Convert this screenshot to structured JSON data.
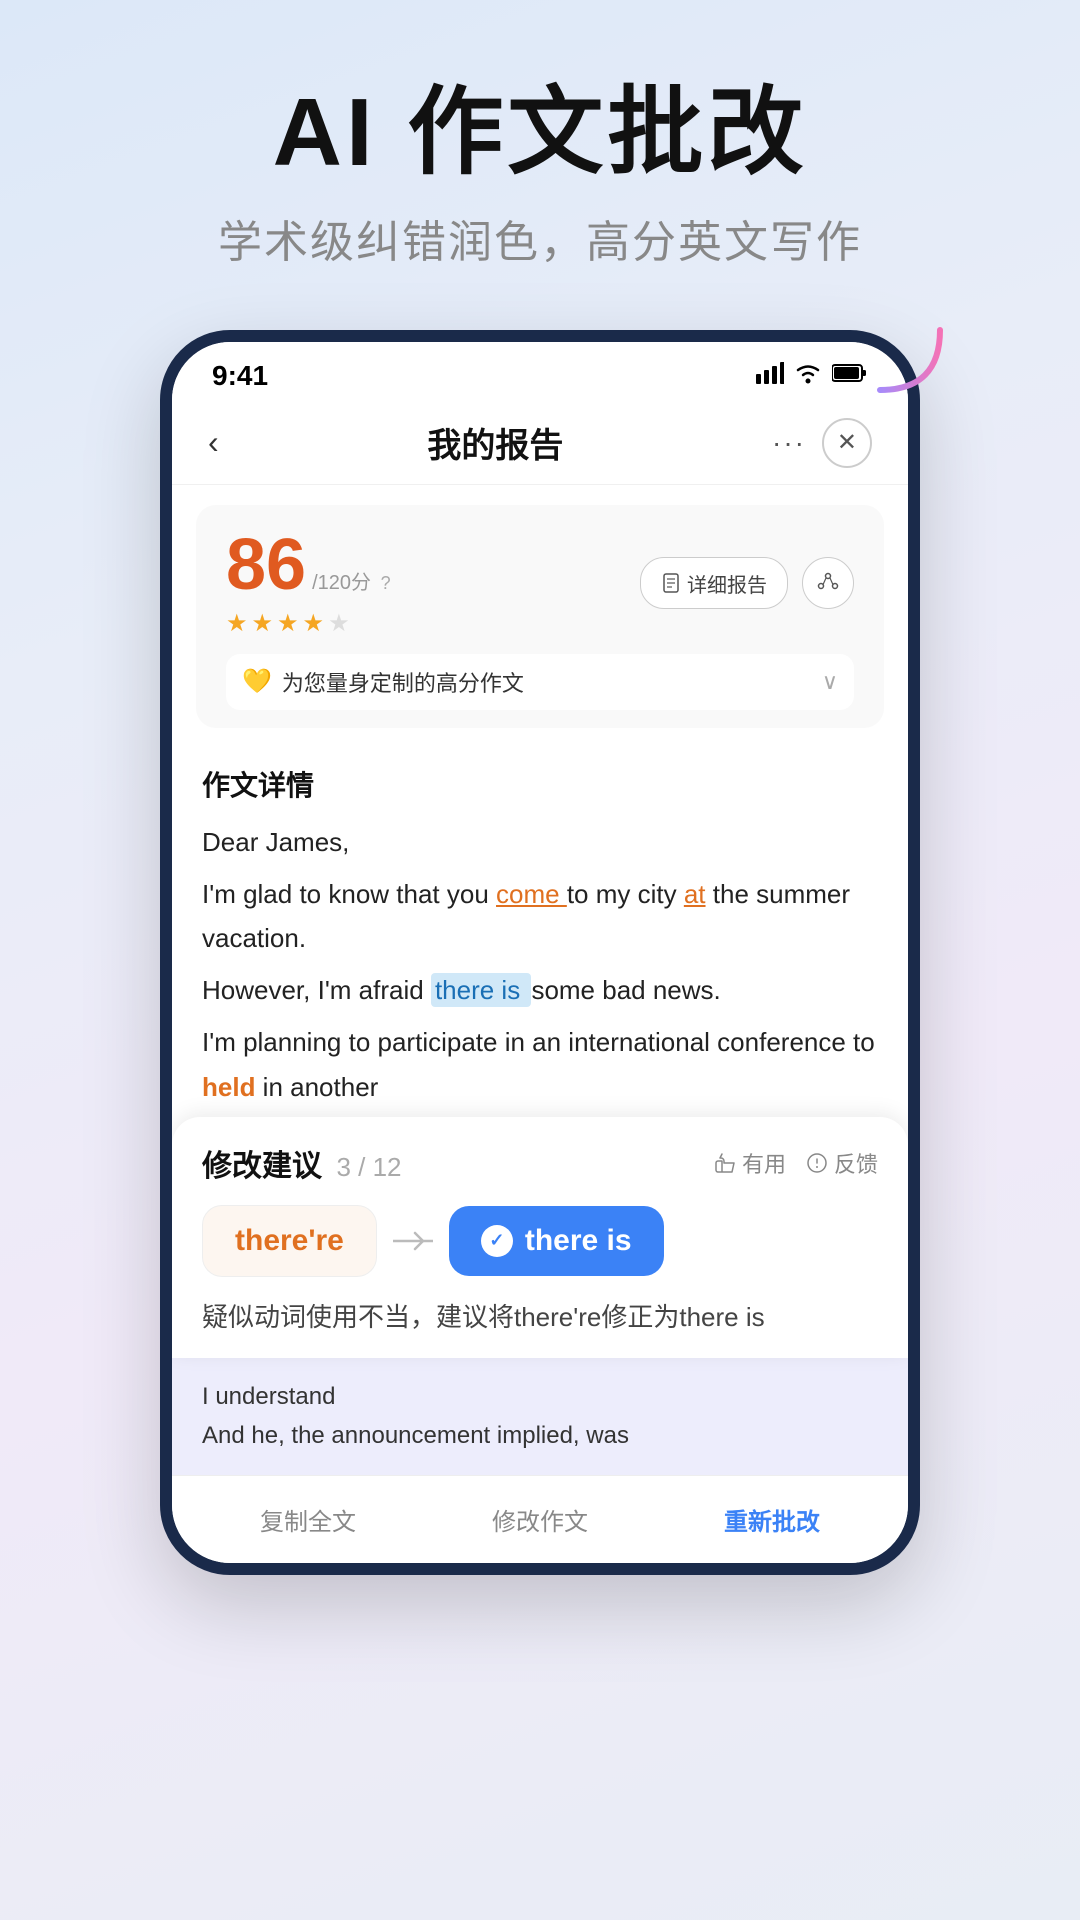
{
  "header": {
    "title": "AI 作文批改",
    "subtitle": "学术级纠错润色，高分英文写作"
  },
  "phone": {
    "status_bar": {
      "time": "9:41"
    },
    "nav": {
      "title": "我的报告",
      "more_label": "···"
    },
    "score_card": {
      "score": "86",
      "score_max": "/120分",
      "score_help": "?",
      "stars_full": 4,
      "stars_empty": 1,
      "btn_report": "详细报告",
      "custom_hint": "为您量身定制的高分作文"
    },
    "essay": {
      "section_title": "作文详情",
      "paragraphs": [
        "Dear James,",
        "I'm glad to know that you come  to my city at the summer vacation.",
        "However, I'm afraid there is some bad news.",
        "I'm planning to participate in an international conference to held in another"
      ]
    },
    "suggestion": {
      "title": "修改建议",
      "current": "3",
      "total": "12",
      "action_useful": "有用",
      "action_feedback": "反馈",
      "original_word": "there're",
      "corrected_word": "there is",
      "description": "疑似动词使用不当，建议将there're修正为there is"
    },
    "examples": [
      "I understand",
      "And he, the announcement implied, was"
    ],
    "toolbar": {
      "copy": "复制全文",
      "edit": "修改作文",
      "recheck": "重新批改"
    }
  },
  "colors": {
    "orange": "#e07020",
    "blue": "#3b82f6",
    "blue_highlight_bg": "#d0e8f8",
    "star_gold": "#f5a623"
  }
}
